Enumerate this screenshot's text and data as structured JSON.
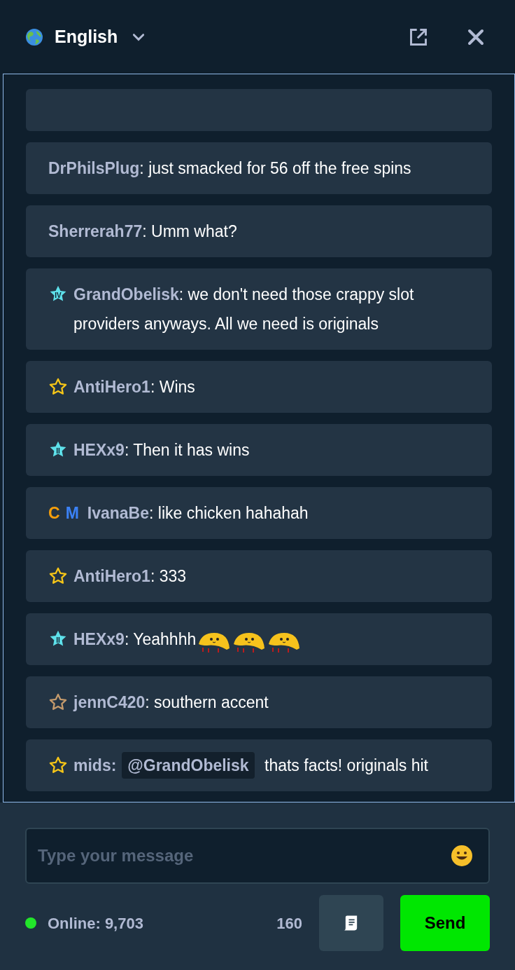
{
  "header": {
    "language": "English"
  },
  "messages": [
    {
      "user": "DrPhilsPlug",
      "parts": [
        {
          "kind": "text",
          "text": ": just smacked for 56 off the free spins"
        }
      ]
    },
    {
      "user": "Sherrerah77",
      "parts": [
        {
          "kind": "text",
          "text": ": Umm what?"
        }
      ]
    },
    {
      "badge": {
        "kind": "rank",
        "numeral": "IV",
        "color": "#5ee0ea"
      },
      "user": "GrandObelisk",
      "parts": [
        {
          "kind": "text",
          "text": ": we don't need those crappy slot providers anyways. All we need is originals"
        }
      ]
    },
    {
      "badge": {
        "kind": "star",
        "color": "#f5c518"
      },
      "user": "AntiHero1",
      "parts": [
        {
          "kind": "text",
          "text": ": Wins"
        }
      ]
    },
    {
      "badge": {
        "kind": "rank",
        "numeral": "II",
        "color": "#5ee0ea"
      },
      "user": "HEXx9",
      "parts": [
        {
          "kind": "text",
          "text": ": Then it has wins"
        }
      ]
    },
    {
      "badge": {
        "kind": "cm",
        "letters": [
          "C",
          "M"
        ]
      },
      "user": "IvanaBe",
      "parts": [
        {
          "kind": "text",
          "text": ": like chicken hahahah"
        }
      ]
    },
    {
      "badge": {
        "kind": "star",
        "color": "#f5c518"
      },
      "user": "AntiHero1",
      "parts": [
        {
          "kind": "text",
          "text": ": 333"
        }
      ]
    },
    {
      "badge": {
        "kind": "rank",
        "numeral": "II",
        "color": "#5ee0ea"
      },
      "user": "HEXx9",
      "parts": [
        {
          "kind": "text",
          "text": ": Yeahhhh"
        },
        {
          "kind": "emote"
        },
        {
          "kind": "emote"
        },
        {
          "kind": "emote"
        }
      ]
    },
    {
      "badge": {
        "kind": "star",
        "color": "#c49a6c"
      },
      "user": "jennC420",
      "parts": [
        {
          "kind": "text",
          "text": ": southern accent"
        }
      ]
    },
    {
      "badge": {
        "kind": "star",
        "color": "#f5c518"
      },
      "user": "mids:",
      "parts": [
        {
          "kind": "mention",
          "text": "@GrandObelisk"
        },
        {
          "kind": "text",
          "text": " thats facts! originals hit"
        }
      ]
    }
  ],
  "composer": {
    "placeholder": "Type your message"
  },
  "footer": {
    "online": "Online: 9,703",
    "char_count": "160",
    "send": "Send"
  }
}
